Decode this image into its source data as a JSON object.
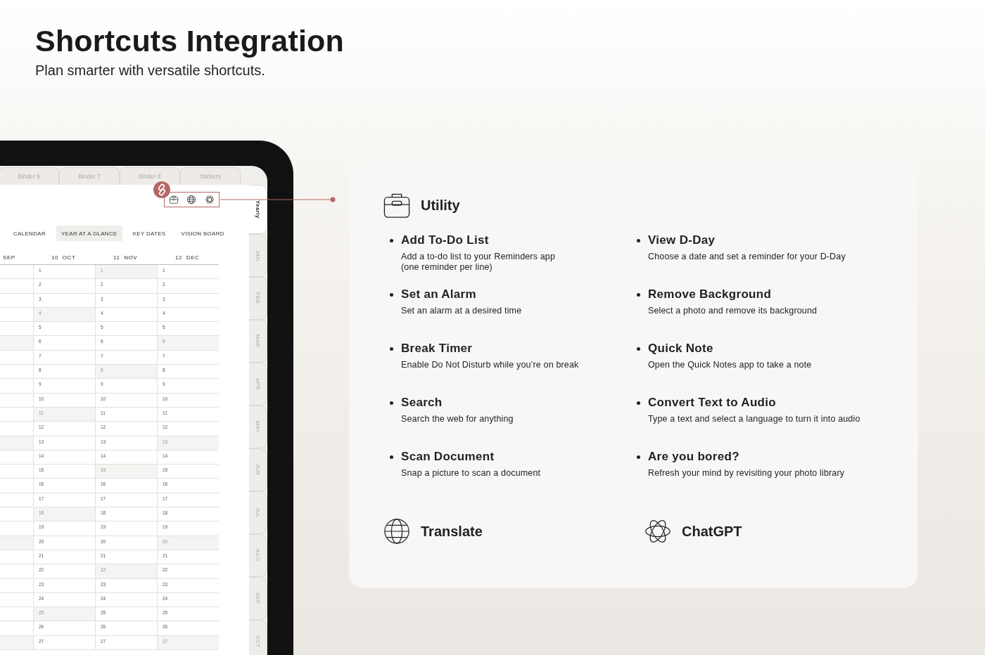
{
  "header": {
    "title": "Shortcuts Integration",
    "subtitle": "Plan smarter with versatile shortcuts."
  },
  "tablet": {
    "binder_tabs": [
      {
        "label": "Binder 6",
        "selected": false
      },
      {
        "label": "Binder 7",
        "selected": false
      },
      {
        "label": "Binder 8",
        "selected": false
      },
      {
        "label": "Stickers",
        "selected": false
      }
    ],
    "side_tabs": [
      {
        "label": "Yearly",
        "selected": true
      },
      {
        "label": "JAN",
        "selected": false
      },
      {
        "label": "FEB",
        "selected": false
      },
      {
        "label": "MAR",
        "selected": false
      },
      {
        "label": "APR",
        "selected": false
      },
      {
        "label": "MAY",
        "selected": false
      },
      {
        "label": "JUN",
        "selected": false
      },
      {
        "label": "JUL",
        "selected": false
      },
      {
        "label": "AUG",
        "selected": false
      },
      {
        "label": "SEP",
        "selected": false
      },
      {
        "label": "OCT",
        "selected": false
      }
    ],
    "nav_tabs": [
      {
        "label": "CALENDAR",
        "selected": false
      },
      {
        "label": "YEAR AT A GLANCE",
        "selected": true
      },
      {
        "label": "KEY DATES",
        "selected": false
      },
      {
        "label": "VISION BOARD",
        "selected": false
      }
    ],
    "months": [
      {
        "name": "SEP"
      },
      {
        "number": "10",
        "name": "OCT"
      },
      {
        "number": "11",
        "name": "NOV"
      },
      {
        "number": "12",
        "name": "DEC"
      }
    ],
    "rows": [
      [
        {
          "shaded": false
        },
        {
          "text": "1",
          "shaded": false
        },
        {
          "text": "1",
          "shaded": true
        },
        {
          "text": "1",
          "shaded": false
        }
      ],
      [
        {
          "shaded": false
        },
        {
          "text": "2",
          "shaded": false
        },
        {
          "text": "2",
          "shaded": false
        },
        {
          "text": "2",
          "shaded": false
        }
      ],
      [
        {
          "shaded": false
        },
        {
          "text": "3",
          "shaded": false
        },
        {
          "text": "3",
          "shaded": false
        },
        {
          "text": "3",
          "shaded": false
        }
      ],
      [
        {
          "shaded": false
        },
        {
          "text": "4",
          "shaded": true
        },
        {
          "text": "4",
          "shaded": false
        },
        {
          "text": "4",
          "shaded": false
        }
      ],
      [
        {
          "shaded": false
        },
        {
          "text": "5",
          "shaded": false
        },
        {
          "text": "5",
          "shaded": false
        },
        {
          "text": "5",
          "shaded": false
        }
      ],
      [
        {
          "shaded": true
        },
        {
          "text": "6",
          "shaded": false
        },
        {
          "text": "6",
          "shaded": false
        },
        {
          "text": "6",
          "shaded": true
        }
      ],
      [
        {
          "shaded": false
        },
        {
          "text": "7",
          "shaded": false
        },
        {
          "text": "7",
          "shaded": false
        },
        {
          "text": "7",
          "shaded": false
        }
      ],
      [
        {
          "shaded": false
        },
        {
          "text": "8",
          "shaded": false
        },
        {
          "text": "8",
          "shaded": true
        },
        {
          "text": "8",
          "shaded": false
        }
      ],
      [
        {
          "shaded": false
        },
        {
          "text": "9",
          "shaded": false
        },
        {
          "text": "9",
          "shaded": false
        },
        {
          "text": "9",
          "shaded": false
        }
      ],
      [
        {
          "shaded": false
        },
        {
          "text": "10",
          "shaded": false
        },
        {
          "text": "10",
          "shaded": false
        },
        {
          "text": "10",
          "shaded": false
        }
      ],
      [
        {
          "shaded": false
        },
        {
          "text": "11",
          "shaded": true
        },
        {
          "text": "11",
          "shaded": false
        },
        {
          "text": "11",
          "shaded": false
        }
      ],
      [
        {
          "shaded": false
        },
        {
          "text": "12",
          "shaded": false
        },
        {
          "text": "12",
          "shaded": false
        },
        {
          "text": "12",
          "shaded": false
        }
      ],
      [
        {
          "shaded": true
        },
        {
          "text": "13",
          "shaded": false
        },
        {
          "text": "13",
          "shaded": false
        },
        {
          "text": "13",
          "shaded": true
        }
      ],
      [
        {
          "shaded": false
        },
        {
          "text": "14",
          "shaded": false
        },
        {
          "text": "14",
          "shaded": false
        },
        {
          "text": "14",
          "shaded": false
        }
      ],
      [
        {
          "shaded": false
        },
        {
          "text": "15",
          "shaded": false
        },
        {
          "text": "15",
          "shaded": true
        },
        {
          "text": "15",
          "shaded": false
        }
      ],
      [
        {
          "shaded": false
        },
        {
          "text": "16",
          "shaded": false
        },
        {
          "text": "16",
          "shaded": false
        },
        {
          "text": "16",
          "shaded": false
        }
      ],
      [
        {
          "shaded": false
        },
        {
          "text": "17",
          "shaded": false
        },
        {
          "text": "17",
          "shaded": false
        },
        {
          "text": "17",
          "shaded": false
        }
      ],
      [
        {
          "shaded": false
        },
        {
          "text": "18",
          "shaded": true
        },
        {
          "text": "18",
          "shaded": false
        },
        {
          "text": "18",
          "shaded": false
        }
      ],
      [
        {
          "shaded": false
        },
        {
          "text": "19",
          "shaded": false
        },
        {
          "text": "19",
          "shaded": false
        },
        {
          "text": "19",
          "shaded": false
        }
      ],
      [
        {
          "shaded": true
        },
        {
          "text": "20",
          "shaded": false
        },
        {
          "text": "20",
          "shaded": false
        },
        {
          "text": "20",
          "shaded": true
        }
      ],
      [
        {
          "shaded": false
        },
        {
          "text": "21",
          "shaded": false
        },
        {
          "text": "21",
          "shaded": false
        },
        {
          "text": "21",
          "shaded": false
        }
      ],
      [
        {
          "shaded": false
        },
        {
          "text": "22",
          "shaded": false
        },
        {
          "text": "22",
          "shaded": true
        },
        {
          "text": "22",
          "shaded": false
        }
      ],
      [
        {
          "shaded": false
        },
        {
          "text": "23",
          "shaded": false
        },
        {
          "text": "23",
          "shaded": false
        },
        {
          "text": "23",
          "shaded": false
        }
      ],
      [
        {
          "shaded": false
        },
        {
          "text": "24",
          "shaded": false
        },
        {
          "text": "24",
          "shaded": false
        },
        {
          "text": "24",
          "shaded": false
        }
      ],
      [
        {
          "shaded": false
        },
        {
          "text": "25",
          "shaded": true
        },
        {
          "text": "25",
          "shaded": false
        },
        {
          "text": "25",
          "shaded": false
        }
      ],
      [
        {
          "shaded": false
        },
        {
          "text": "26",
          "shaded": false
        },
        {
          "text": "26",
          "shaded": false
        },
        {
          "text": "26",
          "shaded": false
        }
      ],
      [
        {
          "shaded": true
        },
        {
          "text": "27",
          "shaded": false
        },
        {
          "text": "27",
          "shaded": false
        },
        {
          "text": "27",
          "shaded": true
        }
      ]
    ]
  },
  "utility": {
    "title": "Utility",
    "items": [
      {
        "title": "Add To-Do List",
        "description": "Add a to-do list to your Reminders app\n(one reminder per line)"
      },
      {
        "title": "View D-Day",
        "description": "Choose a date and set a reminder for your D-Day"
      },
      {
        "title": "Set an Alarm",
        "description": "Set an alarm at a desired time"
      },
      {
        "title": "Remove Background",
        "description": "Select a photo and remove its background"
      },
      {
        "title": "Break Timer",
        "description": "Enable Do Not Disturb while you’re on break"
      },
      {
        "title": "Quick Note",
        "description": "Open the Quick Notes app to take a note"
      },
      {
        "title": "Search",
        "description": "Search the web for anything"
      },
      {
        "title": "Convert Text to Audio",
        "description": "Type a text and select a language to turn it into audio"
      },
      {
        "title": "Scan Document",
        "description": "Snap a picture to scan a document"
      },
      {
        "title": "Are you bored?",
        "description": "Refresh your mind by revisiting your photo library"
      }
    ]
  },
  "extras": [
    {
      "kind": "translate",
      "label": "Translate"
    },
    {
      "kind": "chatgpt",
      "label": "ChatGPT"
    }
  ]
}
